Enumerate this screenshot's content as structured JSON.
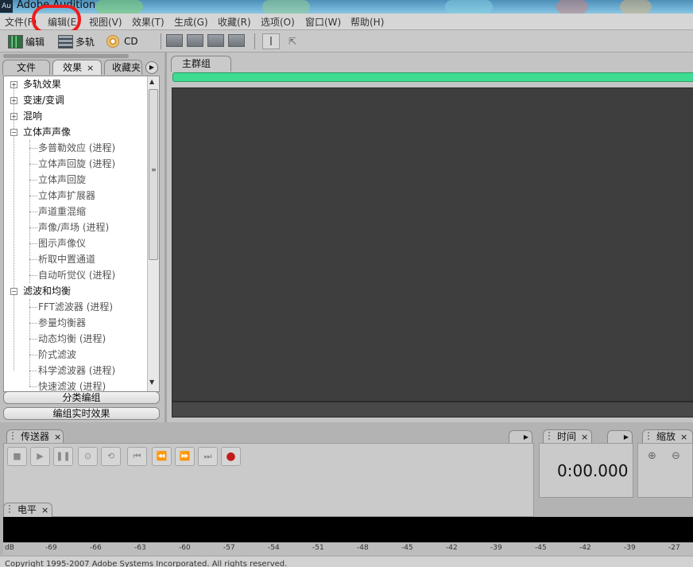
{
  "window": {
    "app_icon": "Au",
    "title": "Adobe Audition"
  },
  "menu": [
    "文件(F)",
    "编辑(E)",
    "视图(V)",
    "效果(T)",
    "生成(G)",
    "收藏(R)",
    "选项(O)",
    "窗口(W)",
    "帮助(H)"
  ],
  "toolbar": {
    "edit_label": "编辑",
    "multitrack_label": "多轨",
    "cd_label": "CD"
  },
  "left_panel": {
    "tabs": [
      "文件",
      "效果",
      "收藏夹"
    ],
    "tree": [
      {
        "label": "多轨效果",
        "type": "category",
        "state": "collapsed"
      },
      {
        "label": "变速/变调",
        "type": "category",
        "state": "collapsed"
      },
      {
        "label": "混响",
        "type": "category",
        "state": "collapsed"
      },
      {
        "label": "立体声声像",
        "type": "category",
        "state": "expanded"
      },
      {
        "label": "多普勒效应 (进程)",
        "type": "leaf"
      },
      {
        "label": "立体声回旋 (进程)",
        "type": "leaf"
      },
      {
        "label": "立体声回旋",
        "type": "leaf"
      },
      {
        "label": "立体声扩展器",
        "type": "leaf"
      },
      {
        "label": "声道重混缩",
        "type": "leaf"
      },
      {
        "label": "声像/声场 (进程)",
        "type": "leaf"
      },
      {
        "label": "图示声像仪",
        "type": "leaf"
      },
      {
        "label": "析取中置通道",
        "type": "leaf"
      },
      {
        "label": "自动听觉仪 (进程)",
        "type": "leaf"
      },
      {
        "label": "滤波和均衡",
        "type": "category",
        "state": "expanded"
      },
      {
        "label": "FFT滤波器 (进程)",
        "type": "leaf"
      },
      {
        "label": "参量均衡器",
        "type": "leaf"
      },
      {
        "label": "动态均衡 (进程)",
        "type": "leaf"
      },
      {
        "label": "阶式滤波",
        "type": "leaf"
      },
      {
        "label": "科学滤波器 (进程)",
        "type": "leaf"
      },
      {
        "label": "快速滤波 (进程)",
        "type": "leaf"
      }
    ],
    "group_button": "分类编组",
    "realtime_button": "编组实时效果"
  },
  "main": {
    "tab_label": "主群组"
  },
  "transport": {
    "tab_label": "传送器"
  },
  "time": {
    "tab_label": "时间",
    "display": "0:00.000"
  },
  "zoom": {
    "tab_label": "缩放"
  },
  "level": {
    "tab_label": "电平",
    "ticks": [
      "dB",
      "-69",
      "-66",
      "-63",
      "-60",
      "-57",
      "-54",
      "-51",
      "-48",
      "-45",
      "-42",
      "-39",
      "-45",
      "-42",
      "-39",
      "-27"
    ]
  },
  "status": {
    "copyright": "Copyright 1995-2007 Adobe Systems Incorporated. All rights reserved."
  },
  "colors": {
    "highlight": "#ee1d1d",
    "progress": "#3ddc90",
    "track_bg": "#3e3e3e"
  }
}
